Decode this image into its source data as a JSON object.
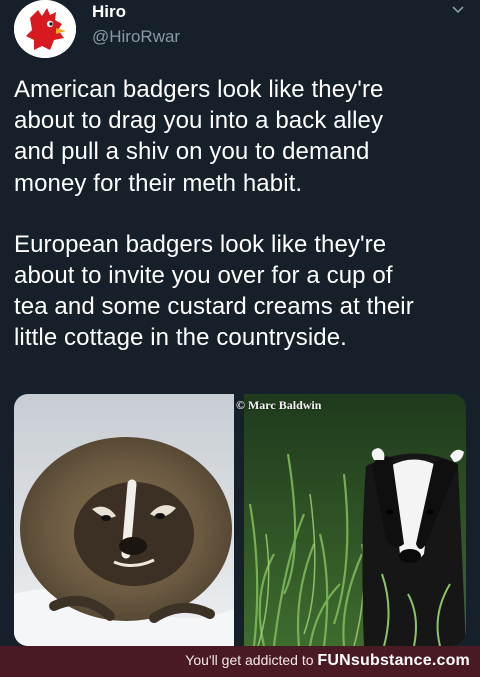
{
  "tweet": {
    "author_name": "Hiro",
    "author_handle": "@HiroRwar",
    "paragraph_1": "American badgers look like they're\nabout to drag you into a back alley\nand pull a shiv on you to demand\nmoney for their meth habit.",
    "paragraph_2": "European badgers look like they're\nabout to invite you over for a cup of\ntea and some custard creams at their\nlittle cottage in the countryside."
  },
  "media": {
    "left_photo": "american-badger-photo",
    "right_photo": "european-badger-photo",
    "photo_credit": "© Marc Baldwin"
  },
  "footer": {
    "prefix": "You'll get addicted to ",
    "brand": "FUNsubstance.com"
  },
  "colors": {
    "background": "#15202b",
    "handle": "#8899a6",
    "footer_bg": "#4a1a24"
  }
}
